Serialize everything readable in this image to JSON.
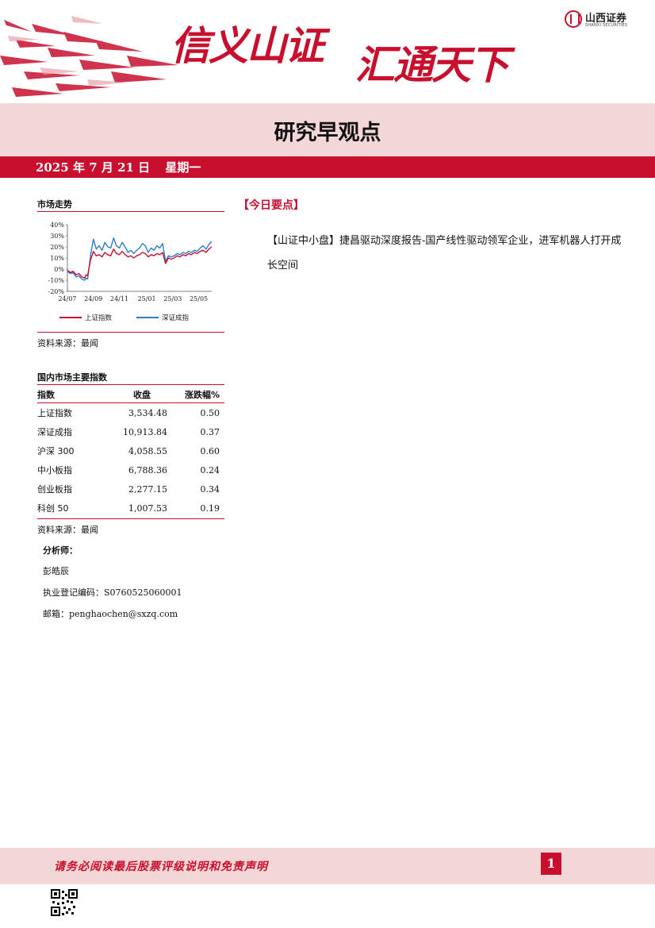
{
  "header": {
    "slogan_part1": "信义山证",
    "slogan_part2": "汇通天下",
    "logo_cn": "山西证券",
    "logo_en": "SHANXI SECURITIES",
    "report_title": "研究早观点"
  },
  "date_bar": {
    "date": "2025 年 7 月 21 日",
    "weekday": "星期一"
  },
  "market_trend": {
    "section_title": "市场走势",
    "source": "资料来源：最闻"
  },
  "chart_data": {
    "type": "line",
    "title": "",
    "xlabel": "",
    "ylabel": "",
    "x_ticks": [
      "24/07",
      "24/09",
      "24/11",
      "25/01",
      "25/03",
      "25/05"
    ],
    "y_ticks": [
      "40%",
      "30%",
      "20%",
      "10%",
      "0%",
      "-10%",
      "-20%"
    ],
    "ylim": [
      -20,
      40
    ],
    "x": [
      0,
      2,
      4,
      6,
      8,
      10,
      12,
      13,
      14,
      16,
      18,
      20,
      22,
      24,
      26,
      28,
      30,
      32,
      34,
      36,
      38,
      40,
      42,
      44,
      46,
      48,
      50,
      52,
      54,
      56,
      58,
      60,
      62,
      64,
      66,
      68,
      70,
      72,
      74,
      76,
      78,
      80,
      82,
      84,
      86,
      88,
      90,
      92,
      94,
      96,
      98,
      100
    ],
    "grid": false,
    "legend_position": "bottom",
    "series": [
      {
        "name": "上证指数",
        "color": "#c8102e",
        "values": [
          -1,
          -3,
          -2,
          -5,
          -4,
          -7,
          -8,
          -5,
          -6,
          8,
          16,
          12,
          13,
          11,
          15,
          13,
          12,
          18,
          14,
          13,
          16,
          13,
          11,
          12,
          10,
          12,
          13,
          15,
          14,
          11,
          13,
          12,
          14,
          13,
          15,
          5,
          10,
          9,
          10,
          12,
          11,
          13,
          12,
          14,
          13,
          15,
          14,
          16,
          17,
          15,
          18,
          20
        ]
      },
      {
        "name": "深证成指",
        "color": "#2e7dc9",
        "values": [
          -2,
          -4,
          -3,
          -7,
          -6,
          -9,
          -10,
          -8,
          -9,
          12,
          27,
          18,
          21,
          17,
          24,
          20,
          19,
          28,
          21,
          19,
          24,
          20,
          15,
          17,
          14,
          17,
          19,
          23,
          21,
          15,
          19,
          17,
          21,
          19,
          23,
          7,
          12,
          11,
          12,
          14,
          13,
          15,
          14,
          16,
          15,
          17,
          16,
          19,
          21,
          18,
          22,
          25
        ]
      }
    ]
  },
  "indices": {
    "section_title": "国内市场主要指数",
    "headers": [
      "指数",
      "收盘",
      "涨跌幅%"
    ],
    "rows": [
      [
        "上证指数",
        "3,534.48",
        "0.50"
      ],
      [
        "深证成指",
        "10,913.84",
        "0.37"
      ],
      [
        "沪深 300",
        "4,058.55",
        "0.60"
      ],
      [
        "中小板指",
        "6,788.36",
        "0.24"
      ],
      [
        "创业板指",
        "2,277.15",
        "0.34"
      ],
      [
        "科创 50",
        "1,007.53",
        "0.19"
      ]
    ],
    "source": "资料来源：最闻"
  },
  "analyst": {
    "label": "分析师：",
    "name": "彭皓辰",
    "license": "执业登记编码：S0760525060001",
    "email": "邮箱：penghaochen@sxzq.com"
  },
  "key_points": {
    "title": "【今日要点】",
    "items": [
      "【山证中小盘】捷昌驱动深度报告-国产线性驱动领军企业，进军机器人打开成长空间"
    ]
  },
  "footer": {
    "disclaimer": "请务必阅读最后股票评级说明和免责声明",
    "page_number": "1"
  }
}
